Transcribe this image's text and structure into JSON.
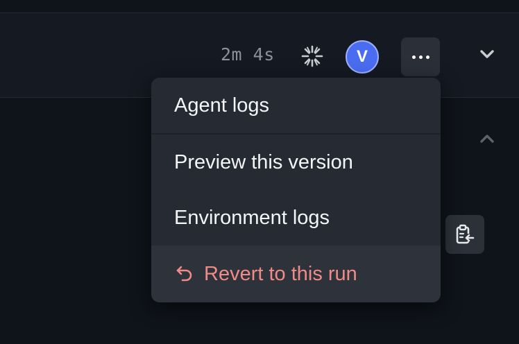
{
  "header": {
    "duration": "2m 4s",
    "status_icon": "loading-spinner-icon",
    "avatar_initial": "V",
    "avatar_color": "#4a6cf0",
    "more_icon": "ellipsis-icon",
    "collapse_icon": "chevron-down-icon"
  },
  "panel": {
    "expand_icon": "chevron-up-icon",
    "clipboard_icon": "clipboard-import-icon"
  },
  "menu": {
    "agent_logs": "Agent logs",
    "preview": "Preview this version",
    "environment_logs": "Environment logs",
    "revert": "Revert to this run",
    "revert_color": "#f08b87"
  }
}
